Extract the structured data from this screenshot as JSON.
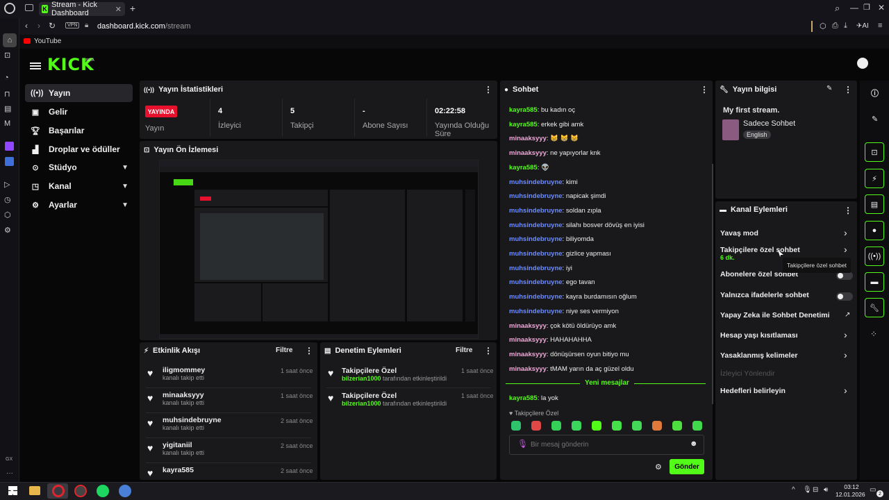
{
  "browser": {
    "tab_title": "Stream - Kick Dashboard",
    "url_domain": "dashboard.kick.com",
    "url_path": "/stream",
    "vpn": "VPN",
    "bookmark": "YouTube",
    "ai": "AI"
  },
  "app": {
    "logo": "KICK",
    "beta": "BETA"
  },
  "nav": [
    {
      "label": "Yayın",
      "icon": "broadcast-icon",
      "active": true
    },
    {
      "label": "Gelir",
      "icon": "wallet-icon"
    },
    {
      "label": "Başarılar",
      "icon": "trophy-icon"
    },
    {
      "label": "Droplar ve ödüller",
      "icon": "gift-icon"
    },
    {
      "label": "Stüdyo",
      "icon": "camera-icon",
      "expand": true
    },
    {
      "label": "Kanal",
      "icon": "tv-icon",
      "expand": true
    },
    {
      "label": "Ayarlar",
      "icon": "gear-icon",
      "expand": true
    }
  ],
  "stats": {
    "title": "Yayın İstatistikleri",
    "live_badge": "YAYINDA",
    "items": [
      {
        "value": "",
        "label": "Yayın"
      },
      {
        "value": "4",
        "label": "İzleyici"
      },
      {
        "value": "5",
        "label": "Takipçi"
      },
      {
        "value": "-",
        "label": "Abone Sayısı"
      },
      {
        "value": "02:22:58",
        "label": "Yayında Olduğu Süre"
      }
    ]
  },
  "preview": {
    "title": "Yayın Ön İzlemesi"
  },
  "activity": {
    "title": "Etkinlik Akışı",
    "filter": "Filtre",
    "items": [
      {
        "name": "iligmommey",
        "sub": "kanalı takip etti",
        "time": "1 saat önce"
      },
      {
        "name": "minaaksyyy",
        "sub": "kanalı takip etti",
        "time": "1 saat önce"
      },
      {
        "name": "muhsindebruyne",
        "sub": "kanalı takip etti",
        "time": "2 saat önce"
      },
      {
        "name": "yigitaniil",
        "sub": "kanalı takip etti",
        "time": "2 saat önce"
      },
      {
        "name": "kayra585",
        "sub": "",
        "time": "2 saat önce"
      }
    ]
  },
  "moderation": {
    "title": "Denetim Eylemleri",
    "filter": "Filtre",
    "items": [
      {
        "name": "Takipçilere Özel",
        "user": "bilzerian1000",
        "sub": "tarafından etkinleştirildi",
        "time": "1 saat önce"
      },
      {
        "name": "Takipçilere Özel",
        "user": "bilzerian1000",
        "sub": "tarafından etkinleştirildi",
        "time": "1 saat önce"
      }
    ]
  },
  "chat": {
    "title": "Sohbet",
    "messages": [
      {
        "user": "kayra585",
        "color": "g",
        "text": "bu kadın oç"
      },
      {
        "user": "kayra585",
        "color": "g",
        "text": "erkek gibi amk"
      },
      {
        "user": "minaaksyyy",
        "color": "p",
        "text": "😸 😸 😸"
      },
      {
        "user": "minaaksyyy",
        "color": "p",
        "text": "ne yapıyorlar knk"
      },
      {
        "user": "kayra585",
        "color": "g",
        "text": "👽"
      },
      {
        "user": "muhsindebruyne",
        "color": "b",
        "text": "kimi"
      },
      {
        "user": "muhsindebruyne",
        "color": "b",
        "text": "napicak şimdi"
      },
      {
        "user": "muhsindebruyne",
        "color": "b",
        "text": "soldan zıpla"
      },
      {
        "user": "muhsindebruyne",
        "color": "b",
        "text": "silahı bosver dövüş en iyisi"
      },
      {
        "user": "muhsindebruyne",
        "color": "b",
        "text": "biliyomda"
      },
      {
        "user": "muhsindebruyne",
        "color": "b",
        "text": "gizlice yapması"
      },
      {
        "user": "muhsindebruyne",
        "color": "b",
        "text": "iyi"
      },
      {
        "user": "muhsindebruyne",
        "color": "b",
        "text": "ego tavan"
      },
      {
        "user": "muhsindebruyne",
        "color": "b",
        "text": "kayra burdamısın oğlum"
      },
      {
        "user": "muhsindebruyne",
        "color": "b",
        "text": "niye ses vermiyon"
      },
      {
        "user": "minaaksyyy",
        "color": "p",
        "text": "çok kötü öldürüyo amk"
      },
      {
        "user": "minaaksyyy",
        "color": "p",
        "text": "HAHAHAHHA"
      },
      {
        "user": "minaaksyyy",
        "color": "p",
        "text": "dönüşürsen oyun bitiyo mu"
      },
      {
        "user": "minaaksyyy",
        "color": "p",
        "text": "tMAM yarın da aç güzel oldu"
      }
    ],
    "new_messages": "Yeni mesajlar",
    "last": {
      "user": "kayra585",
      "text": "la yok"
    },
    "mode": "Takipçilere Özel",
    "placeholder": "Bir mesaj gönderin",
    "send": "Gönder"
  },
  "info": {
    "title": "Yayın bilgisi",
    "stream_title": "My first stream.",
    "category": "Sadece Sohbet",
    "language": "English"
  },
  "actions": {
    "title": "Kanal Eylemleri",
    "items": [
      {
        "label": "Yavaş mod",
        "control": "chevron"
      },
      {
        "label": "Takipçilere özel sohbet",
        "sub": "6 dk.",
        "control": "chevron"
      },
      {
        "label": "Abonelere özel sohbet",
        "control": "toggle"
      },
      {
        "label": "Yalnızca ifadelerle sohbet",
        "control": "toggle"
      },
      {
        "label": "Yapay Zeka ile Sohbet Denetimi",
        "control": "external"
      },
      {
        "label": "Hesap yaşı kısıtlaması",
        "control": "chevron"
      },
      {
        "label": "Yasaklanmış kelimeler",
        "control": "chevron"
      },
      {
        "label": "İzleyici Yönlendir",
        "control": "none",
        "disabled": true
      },
      {
        "label": "Hedefleri belirleyin",
        "control": "chevron"
      }
    ],
    "tooltip": "Takipçilere özel sohbet"
  },
  "taskbar": {
    "time": "03:12",
    "date": "12.01.2026",
    "notif": "2"
  },
  "colors": {
    "accent": "#53fc18",
    "live": "#e8112d",
    "panel": "#19191c"
  }
}
